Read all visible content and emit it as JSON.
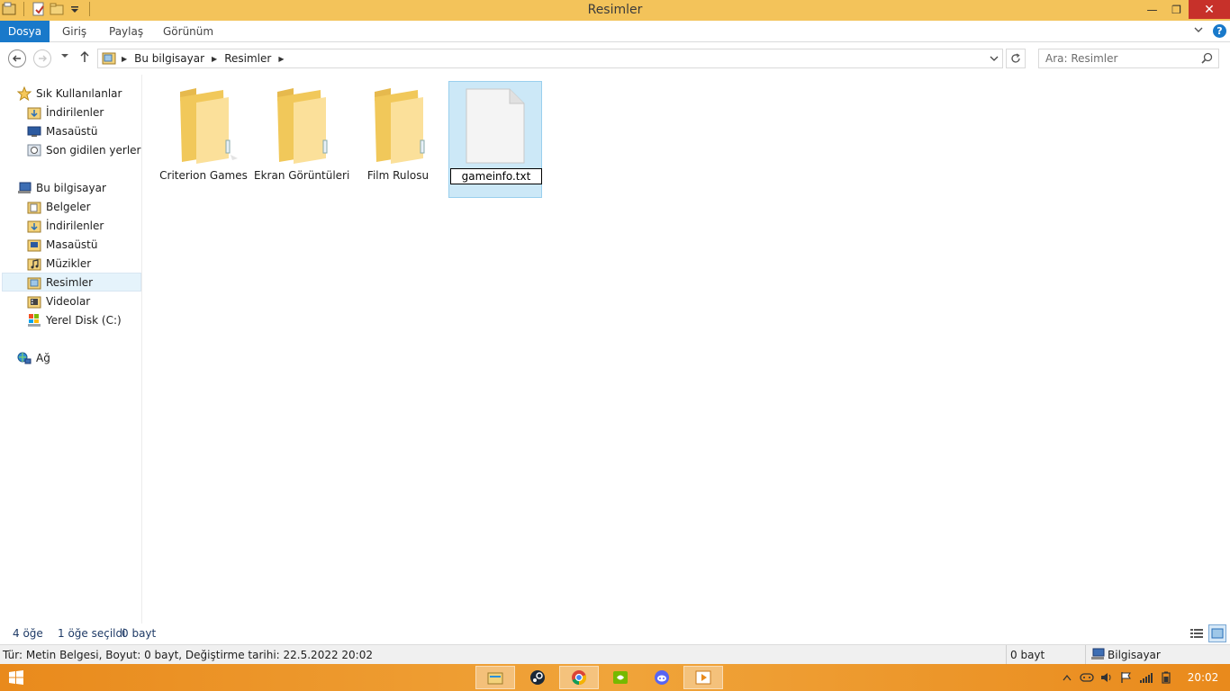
{
  "window": {
    "title": "Resimler",
    "minimize_glyph": "—",
    "restore_glyph": "❐",
    "close_glyph": "✕"
  },
  "ribbon": {
    "tabs": [
      "Dosya",
      "Giriş",
      "Paylaş",
      "Görünüm"
    ],
    "help_label": "?"
  },
  "address": {
    "crumbs": [
      "Bu bilgisayar",
      "Resimler"
    ],
    "search_placeholder": "Ara: Resimler"
  },
  "nav": {
    "favorites_label": "Sık Kullanılanlar",
    "favorites": [
      "İndirilenler",
      "Masaüstü",
      "Son gidilen yerler"
    ],
    "pc_label": "Bu bilgisayar",
    "pc_items": [
      "Belgeler",
      "İndirilenler",
      "Masaüstü",
      "Müzikler",
      "Resimler",
      "Videolar",
      "Yerel Disk (C:)"
    ],
    "network_label": "Ağ"
  },
  "items": [
    {
      "name": "Criterion Games",
      "type": "folder"
    },
    {
      "name": "Ekran Görüntüleri",
      "type": "folder"
    },
    {
      "name": "Film Rulosu",
      "type": "folder"
    },
    {
      "name": "gameinfo.txt",
      "type": "file",
      "renaming": true
    }
  ],
  "status": {
    "count": "4 öğe",
    "selected": "1 öğe seçildi",
    "selected_size": "0 bayt"
  },
  "details": {
    "info": "Tür: Metin Belgesi, Boyut: 0 bayt, Değiştirme tarihi: 22.5.2022 20:02",
    "size": "0 bayt",
    "location": "Bilgisayar"
  },
  "taskbar": {
    "time": "20:02"
  },
  "colors": {
    "titlebar": "#f3c35a",
    "file_tab": "#1979ca",
    "selection": "#cce8f7",
    "taskbar": "#e98a1c"
  }
}
